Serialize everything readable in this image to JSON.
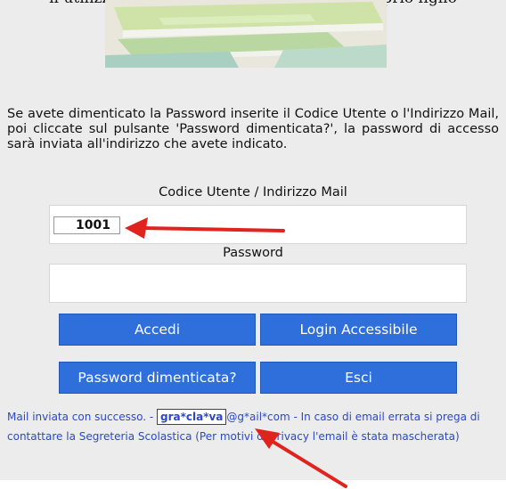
{
  "header": {
    "top_text": "il utilizzato per l'iscrizione ONLINE del proprio figlio"
  },
  "intro": {
    "text": "Se avete dimenticato la Password inserite il Codice Utente o l'Indirizzo Mail, poi cliccate sul pulsante 'Password dimenticata?', la password di accesso sarà inviata all'indirizzo che avete indicato."
  },
  "form": {
    "user_label": "Codice Utente / Indirizzo Mail",
    "user_value": "1001",
    "password_label": "Password",
    "password_value": ""
  },
  "buttons": {
    "login": "Accedi",
    "accessible_login": "Login Accessibile",
    "forgot_password": "Password dimenticata?",
    "exit": "Esci"
  },
  "message": {
    "prefix": "Mail inviata con successo. - ",
    "masked_local": "gra*cla*va",
    "rest": "@g*ail*com - In caso di email errata si prega di contattare la Segreteria Scolastica (Per motivi di privacy l'email è stata mascherata)"
  },
  "colors": {
    "panel_bg": "#ececec",
    "button_bg": "#2e6fdb",
    "message_text": "#2b48c8",
    "annotation_arrow": "#e0231c"
  }
}
